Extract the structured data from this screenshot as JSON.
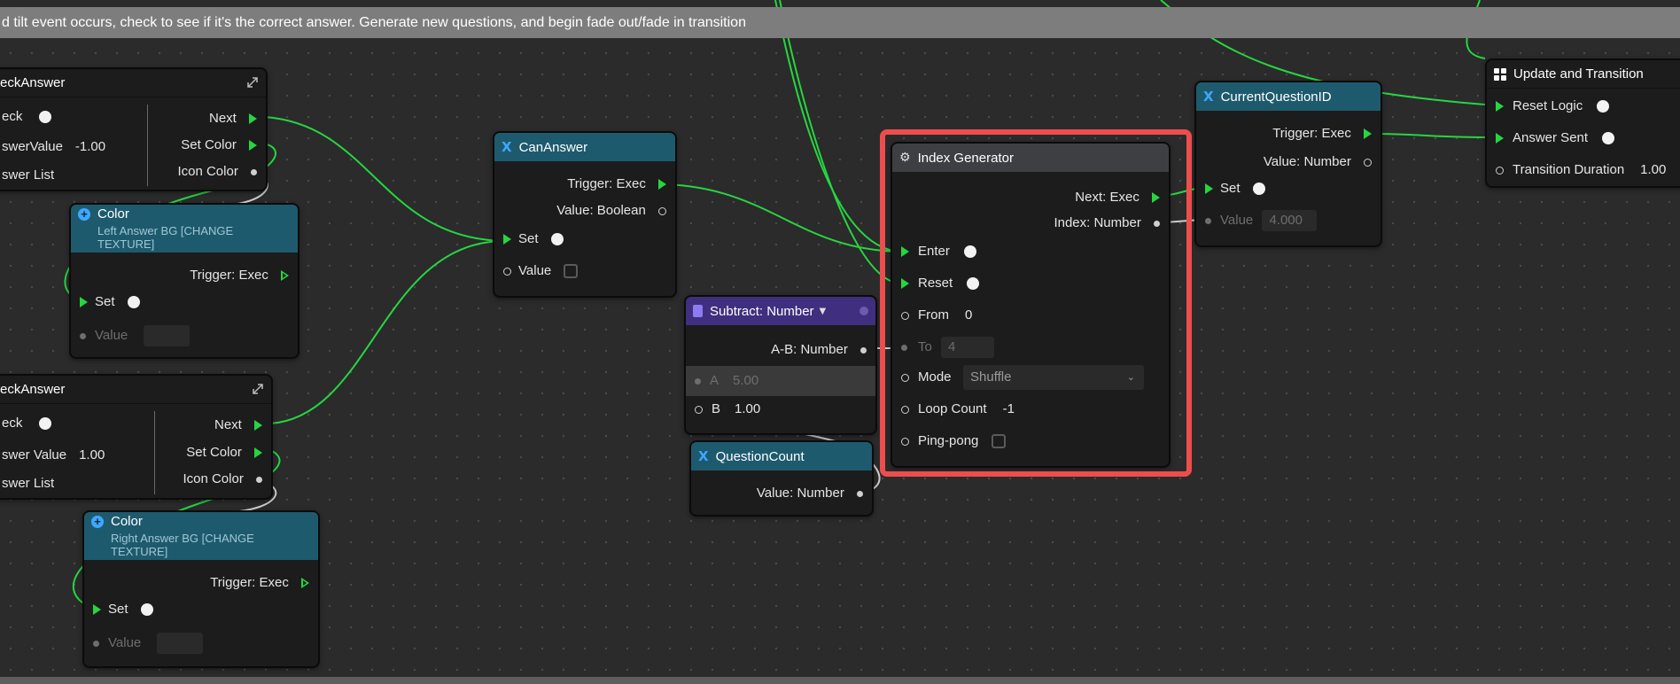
{
  "banner": {
    "text": "d tilt event occurs, check to see if it's the correct answer. Generate new questions, and begin fade out/fade in transition"
  },
  "check_answer_top": {
    "title": "eckAnswer",
    "labels": {
      "check": "eck",
      "answer_value": "swerValue",
      "answer_value_num": "-1.00",
      "answer_list": "swer List"
    },
    "outputs": {
      "next": "Next",
      "set_color": "Set Color",
      "icon_color": "Icon Color"
    }
  },
  "color_left": {
    "title": "Color",
    "subtitle": "Left Answer BG [CHANGE TEXTURE]",
    "trigger": "Trigger: Exec",
    "set": "Set",
    "value": "Value"
  },
  "check_answer_bottom": {
    "title": "eckAnswer",
    "labels": {
      "check": "eck",
      "answer_value": "swer Value",
      "answer_value_num": "1.00",
      "answer_list": "swer List"
    },
    "outputs": {
      "next": "Next",
      "set_color": "Set Color",
      "icon_color": "Icon Color"
    }
  },
  "color_right": {
    "title": "Color",
    "subtitle": "Right Answer BG [CHANGE TEXTURE]",
    "trigger": "Trigger: Exec",
    "set": "Set",
    "value": "Value"
  },
  "can_answer": {
    "title": "CanAnswer",
    "trigger": "Trigger: Exec",
    "value_out": "Value: Boolean",
    "set": "Set",
    "value": "Value"
  },
  "subtract": {
    "title": "Subtract: Number",
    "output": "A-B: Number",
    "a_label": "A",
    "a_value": "5.00",
    "b_label": "B",
    "b_value": "1.00"
  },
  "question_count": {
    "title": "QuestionCount",
    "value_out": "Value: Number"
  },
  "index_generator": {
    "title": "Index Generator",
    "next": "Next: Exec",
    "index": "Index: Number",
    "enter": "Enter",
    "reset": "Reset",
    "from_label": "From",
    "from_value": "0",
    "to_label": "To",
    "to_value": "4",
    "mode_label": "Mode",
    "mode_value": "Shuffle",
    "loop_label": "Loop Count",
    "loop_value": "-1",
    "pingpong_label": "Ping-pong"
  },
  "current_question": {
    "title": "CurrentQuestionID",
    "trigger": "Trigger: Exec",
    "value_out": "Value: Number",
    "set": "Set",
    "value": "Value",
    "value_num": "4.000"
  },
  "update_transition": {
    "title": "Update and Transition",
    "reset_logic": "Reset Logic",
    "answer_sent": "Answer Sent",
    "transition_label": "Transition Duration",
    "transition_value": "1.00"
  },
  "colors": {
    "wire_exec": "#26d640",
    "wire_data": "#cfcfcf",
    "highlight": "#ee4d4d",
    "teal_header": "#1e5a6e"
  }
}
